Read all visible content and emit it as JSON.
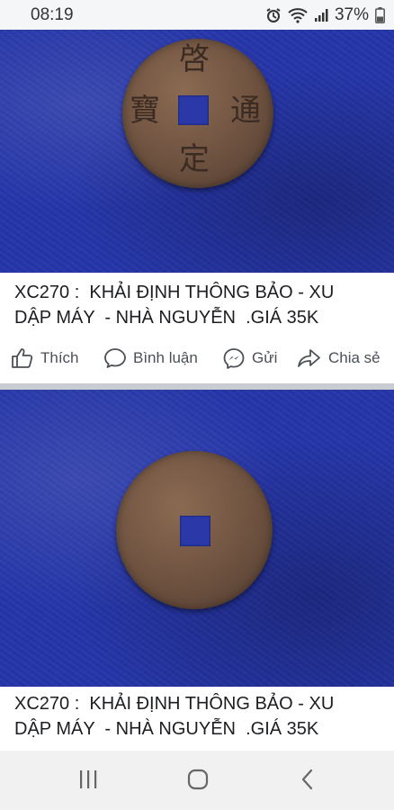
{
  "status_bar": {
    "time": "08:19",
    "battery_percent": "37%",
    "icons": [
      "alarm-icon",
      "wifi-icon",
      "signal-icon",
      "battery-icon"
    ]
  },
  "posts": [
    {
      "image": {
        "description_icon": "coin-obverse",
        "characters": {
          "top": "啓",
          "right": "通",
          "bottom": "定",
          "left": "寶"
        }
      },
      "caption_line1": "XC270 :  KHẢI ĐỊNH THÔNG BẢO - XU",
      "caption_line2": "DẬP MÁY  - NHÀ NGUYỄN  .GIÁ 35K"
    },
    {
      "image": {
        "description_icon": "coin-reverse"
      },
      "caption_line1": "XC270 :  KHẢI ĐỊNH THÔNG BẢO - XU",
      "caption_line2": "DẬP MÁY  - NHÀ NGUYỄN  .GIÁ 35K"
    }
  ],
  "actions": {
    "like": "Thích",
    "comment": "Bình luận",
    "send": "Gửi",
    "share": "Chia sẻ"
  },
  "colors": {
    "photo_background": "#2535a8",
    "coin": "#6e5240",
    "action_text": "#4b4f56",
    "divider": "#c9ccd1"
  }
}
